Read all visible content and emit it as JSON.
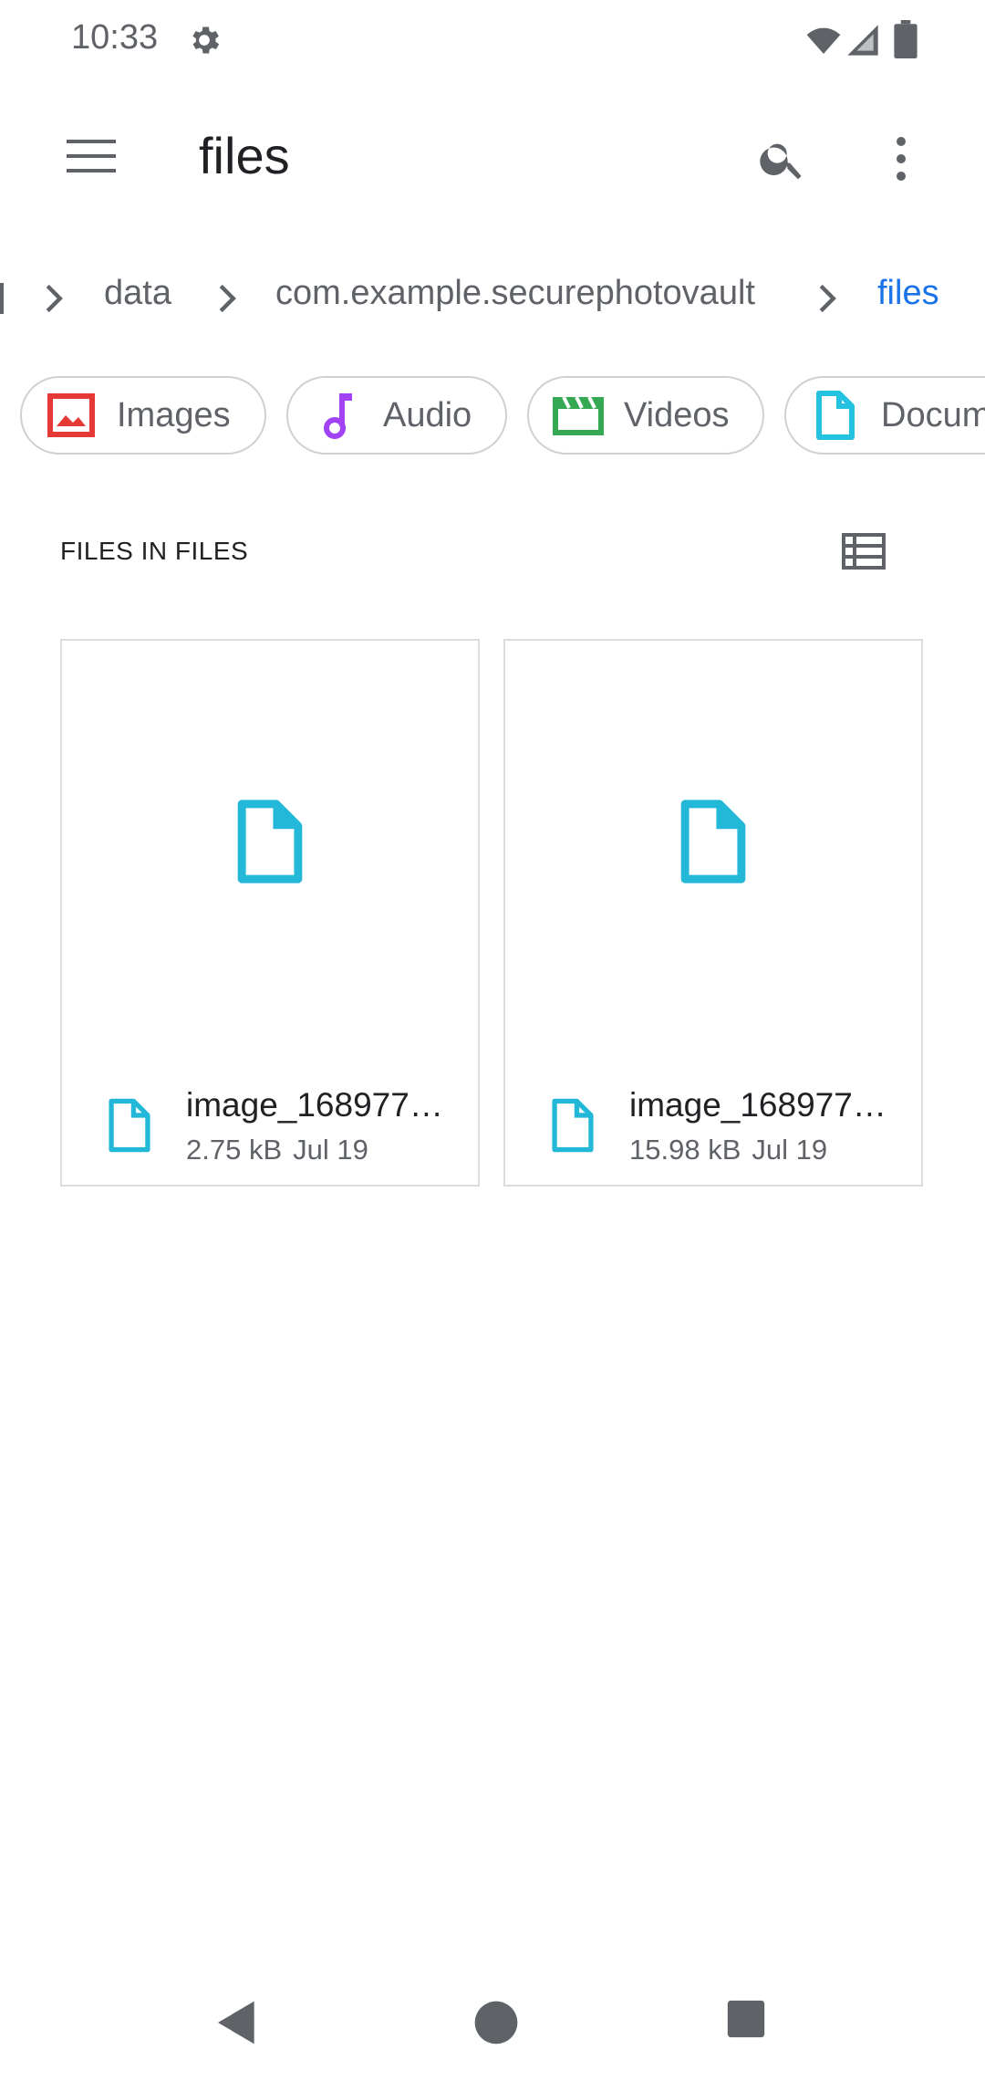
{
  "status_bar": {
    "time": "10:33"
  },
  "app_bar": {
    "title": "files"
  },
  "breadcrumb": {
    "items": [
      {
        "label": "data"
      },
      {
        "label": "com.example.securephotovault"
      },
      {
        "label": "files"
      }
    ]
  },
  "chips": [
    {
      "label": "Images",
      "icon": "image-icon",
      "color": "#e53935"
    },
    {
      "label": "Audio",
      "icon": "music-note-icon",
      "color": "#a142f4"
    },
    {
      "label": "Videos",
      "icon": "movie-icon",
      "color": "#34a853"
    },
    {
      "label": "Documents",
      "icon": "document-icon",
      "color": "#24c1e0"
    }
  ],
  "section": {
    "title": "FILES IN FILES"
  },
  "files": [
    {
      "name": "image_168977…",
      "size": "2.75 kB",
      "date": "Jul 19"
    },
    {
      "name": "image_168977…",
      "size": "15.98 kB",
      "date": "Jul 19"
    }
  ],
  "colors": {
    "accent": "#1a73e8",
    "file_icon": "#24b8d8",
    "text_secondary": "#5f6368"
  }
}
